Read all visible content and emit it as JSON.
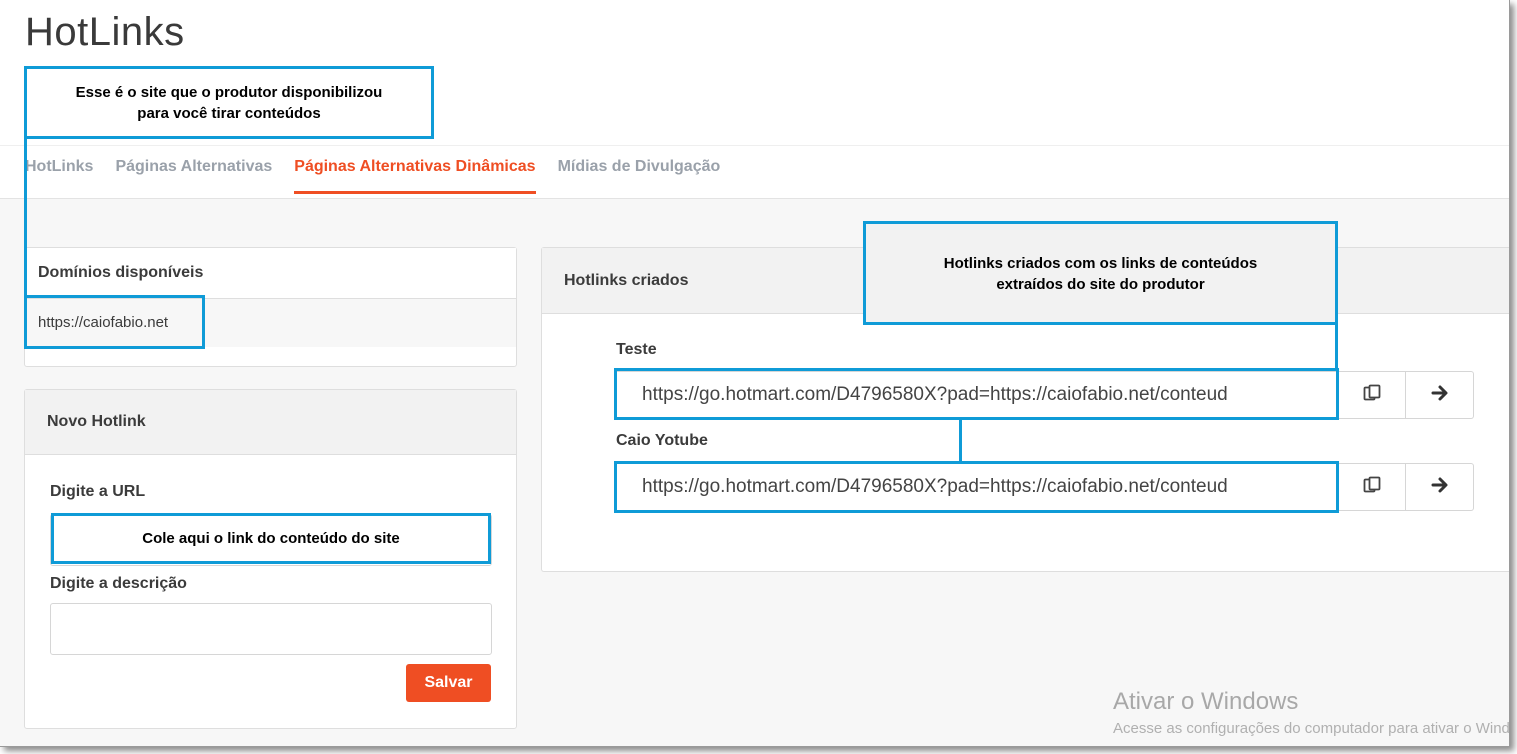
{
  "header": {
    "title": "HotLinks"
  },
  "tabs": [
    {
      "label": "HotLinks",
      "active": false
    },
    {
      "label": "Páginas Alternativas",
      "active": false
    },
    {
      "label": "Páginas Alternativas Dinâmicas",
      "active": true
    },
    {
      "label": "Mídias de Divulgação",
      "active": false
    }
  ],
  "domains_panel": {
    "title": "Domínios disponíveis",
    "domains": [
      "https://caiofabio.net"
    ]
  },
  "new_hotlink_panel": {
    "title": "Novo Hotlink",
    "url_label": "Digite a URL",
    "url_value": "",
    "description_label": "Digite a descrição",
    "description_value": "",
    "save_label": "Salvar"
  },
  "created_panel": {
    "title": "Hotlinks criados",
    "links": [
      {
        "name": "Teste",
        "url": "https://go.hotmart.com/D4796580X?pad=https://caiofabio.net/conteud"
      },
      {
        "name": "Caio Yotube",
        "url": "https://go.hotmart.com/D4796580X?pad=https://caiofabio.net/conteud"
      }
    ],
    "copy_icon": "copy-icon",
    "open_icon": "arrow-right-icon"
  },
  "annotations": {
    "site_note_line1": "Esse é o site que o produtor disponibilizou",
    "site_note_line2": "para você tirar conteúdos",
    "paste_note": "Cole aqui o link do conteúdo do site",
    "created_note_line1": "Hotlinks criados com os links de conteúdos",
    "created_note_line2": "extraídos do site do produtor",
    "color": "#0f9bd7"
  },
  "watermark": {
    "title": "Ativar o Windows",
    "subtitle": "Acesse as configurações do computador para ativar o Windows."
  },
  "colors": {
    "accent": "#ef4e23",
    "tab_inactive": "#9aa1aa",
    "callout_border": "#0f9bd7"
  }
}
